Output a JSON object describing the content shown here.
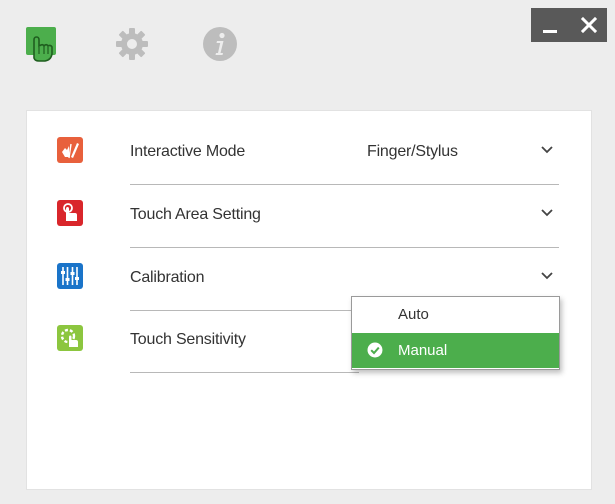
{
  "colors": {
    "accent_green": "#4cae4c",
    "row_icon_interactive": "#e8603c",
    "row_icon_touch_area": "#d9262b",
    "row_icon_calibration": "#1a74c9",
    "row_icon_sensitivity": "#8cc63f",
    "window_controls": "#595959"
  },
  "titlebar": {
    "icons": [
      "touch-hand-icon",
      "gear-icon",
      "info-icon"
    ],
    "controls": {
      "minimize": "_",
      "close": "✕"
    }
  },
  "settings": {
    "rows": [
      {
        "label": "Interactive Mode",
        "value": "Finger/Stylus",
        "icon": "pen-finger-icon"
      },
      {
        "label": "Touch Area Setting",
        "value": "",
        "icon": "touch-area-icon"
      },
      {
        "label": "Calibration",
        "value": "",
        "icon": "sliders-icon"
      },
      {
        "label": "Touch Sensitivity",
        "value": "",
        "icon": "touch-settings-icon"
      }
    ]
  },
  "calibration_dropdown": {
    "options": [
      {
        "label": "Auto",
        "selected": false
      },
      {
        "label": "Manual",
        "selected": true
      }
    ]
  }
}
